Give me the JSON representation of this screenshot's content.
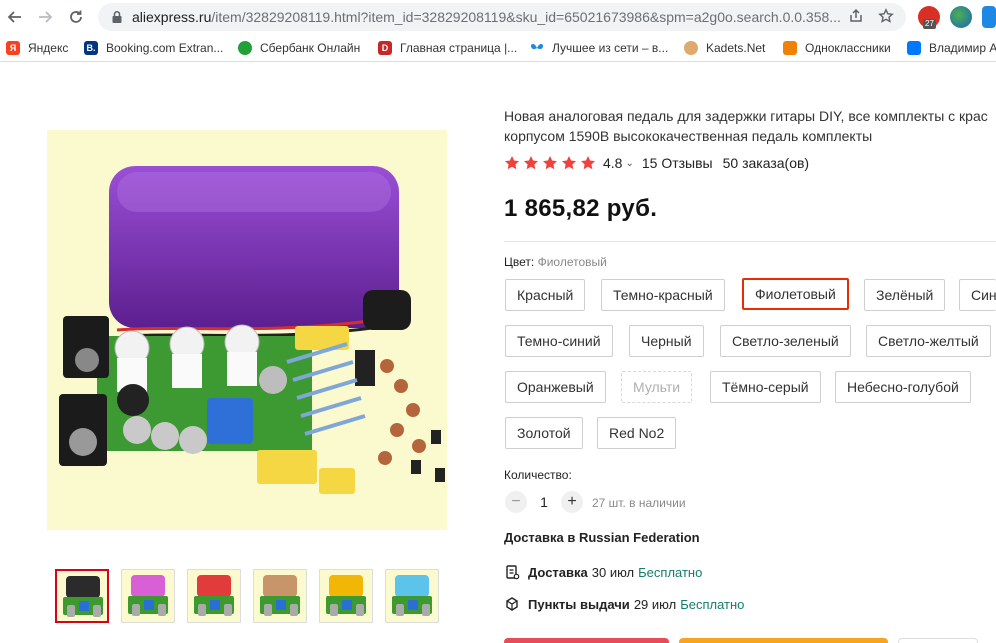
{
  "browser": {
    "url_host": "aliexpress.ru",
    "url_path": "/item/32829208119.html?item_id=32829208119&sku_id=65021673986&spm=a2g0o.search.0.0.358...",
    "ext_badge": "27"
  },
  "bookmarks": [
    {
      "label": "Яндекс",
      "icon": "yandex-icon",
      "color": "#fc3f1d",
      "glyph": "Я"
    },
    {
      "label": "Booking.com Extran...",
      "icon": "booking-icon",
      "color": "#003580",
      "glyph": "B."
    },
    {
      "label": "Сбербанк Онлайн",
      "icon": "sberbank-icon",
      "color": "#21a038",
      "glyph": ""
    },
    {
      "label": "Главная страница |...",
      "icon": "page-icon",
      "color": "#c62828",
      "glyph": "D"
    },
    {
      "label": "Лучшее из сети – в...",
      "icon": "butterfly-icon",
      "color": "#1e88e5",
      "glyph": ""
    },
    {
      "label": "Kadets.Net",
      "icon": "kadets-icon",
      "color": "#e0a96d",
      "glyph": ""
    },
    {
      "label": "Одноклассники",
      "icon": "ok-icon",
      "color": "#ee8208",
      "glyph": "ok"
    },
    {
      "label": "Владимир А",
      "icon": "vk-icon",
      "color": "#0077ff",
      "glyph": "VK"
    }
  ],
  "product": {
    "title_line1": "Новая аналоговая педаль для задержки гитары DIY, все комплекты с крас",
    "title_line2": "корпусом 1590B высококачественная педаль комплекты",
    "rating": "4.8",
    "stars": 5,
    "reviews": "15 Отзывы",
    "orders": "50 заказа(ов)",
    "price": "1 865,82 руб."
  },
  "color_section": {
    "label": "Цвет:",
    "selected": "Фиолетовый",
    "options": [
      {
        "label": "Красный",
        "state": "normal"
      },
      {
        "label": "Темно-красный",
        "state": "normal"
      },
      {
        "label": "Фиолетовый",
        "state": "selected"
      },
      {
        "label": "Зелёный",
        "state": "normal"
      },
      {
        "label": "Син",
        "state": "normal"
      },
      {
        "label": "Темно-синий",
        "state": "normal"
      },
      {
        "label": "Черный",
        "state": "normal"
      },
      {
        "label": "Светло-зеленый",
        "state": "normal"
      },
      {
        "label": "Светло-желтый",
        "state": "normal"
      },
      {
        "label": "Оранжевый",
        "state": "normal"
      },
      {
        "label": "Мульти",
        "state": "disabled"
      },
      {
        "label": "Тёмно-серый",
        "state": "normal"
      },
      {
        "label": "Небесно-голубой",
        "state": "normal"
      },
      {
        "label": "Золотой",
        "state": "normal"
      },
      {
        "label": "Red No2",
        "state": "normal"
      }
    ]
  },
  "quantity": {
    "label": "Количество:",
    "minus": "−",
    "plus": "+",
    "value": "1",
    "stock": "27 шт. в наличии"
  },
  "shipping": {
    "title": "Доставка в Russian Federation",
    "delivery_label": "Доставка",
    "delivery_date": "30 июл",
    "delivery_price": "Бесплатно",
    "pickup_label": "Пункты выдачи",
    "pickup_date": "29 июл",
    "pickup_price": "Бесплатно"
  },
  "thumbnails": [
    {
      "name": "black",
      "color": "#2b2b2b",
      "active": true
    },
    {
      "name": "pink",
      "color": "#d95fd6",
      "active": false
    },
    {
      "name": "red",
      "color": "#e23b3b",
      "active": false
    },
    {
      "name": "tan",
      "color": "#c8956a",
      "active": false
    },
    {
      "name": "gold",
      "color": "#f2b705",
      "active": false
    },
    {
      "name": "sky-blue",
      "color": "#5cc3ea",
      "active": false
    }
  ],
  "colors": {
    "accent": "#e62e04",
    "link_green": "#137d6c",
    "star": "#f0413d",
    "product_purple": "#7a2bb5"
  }
}
